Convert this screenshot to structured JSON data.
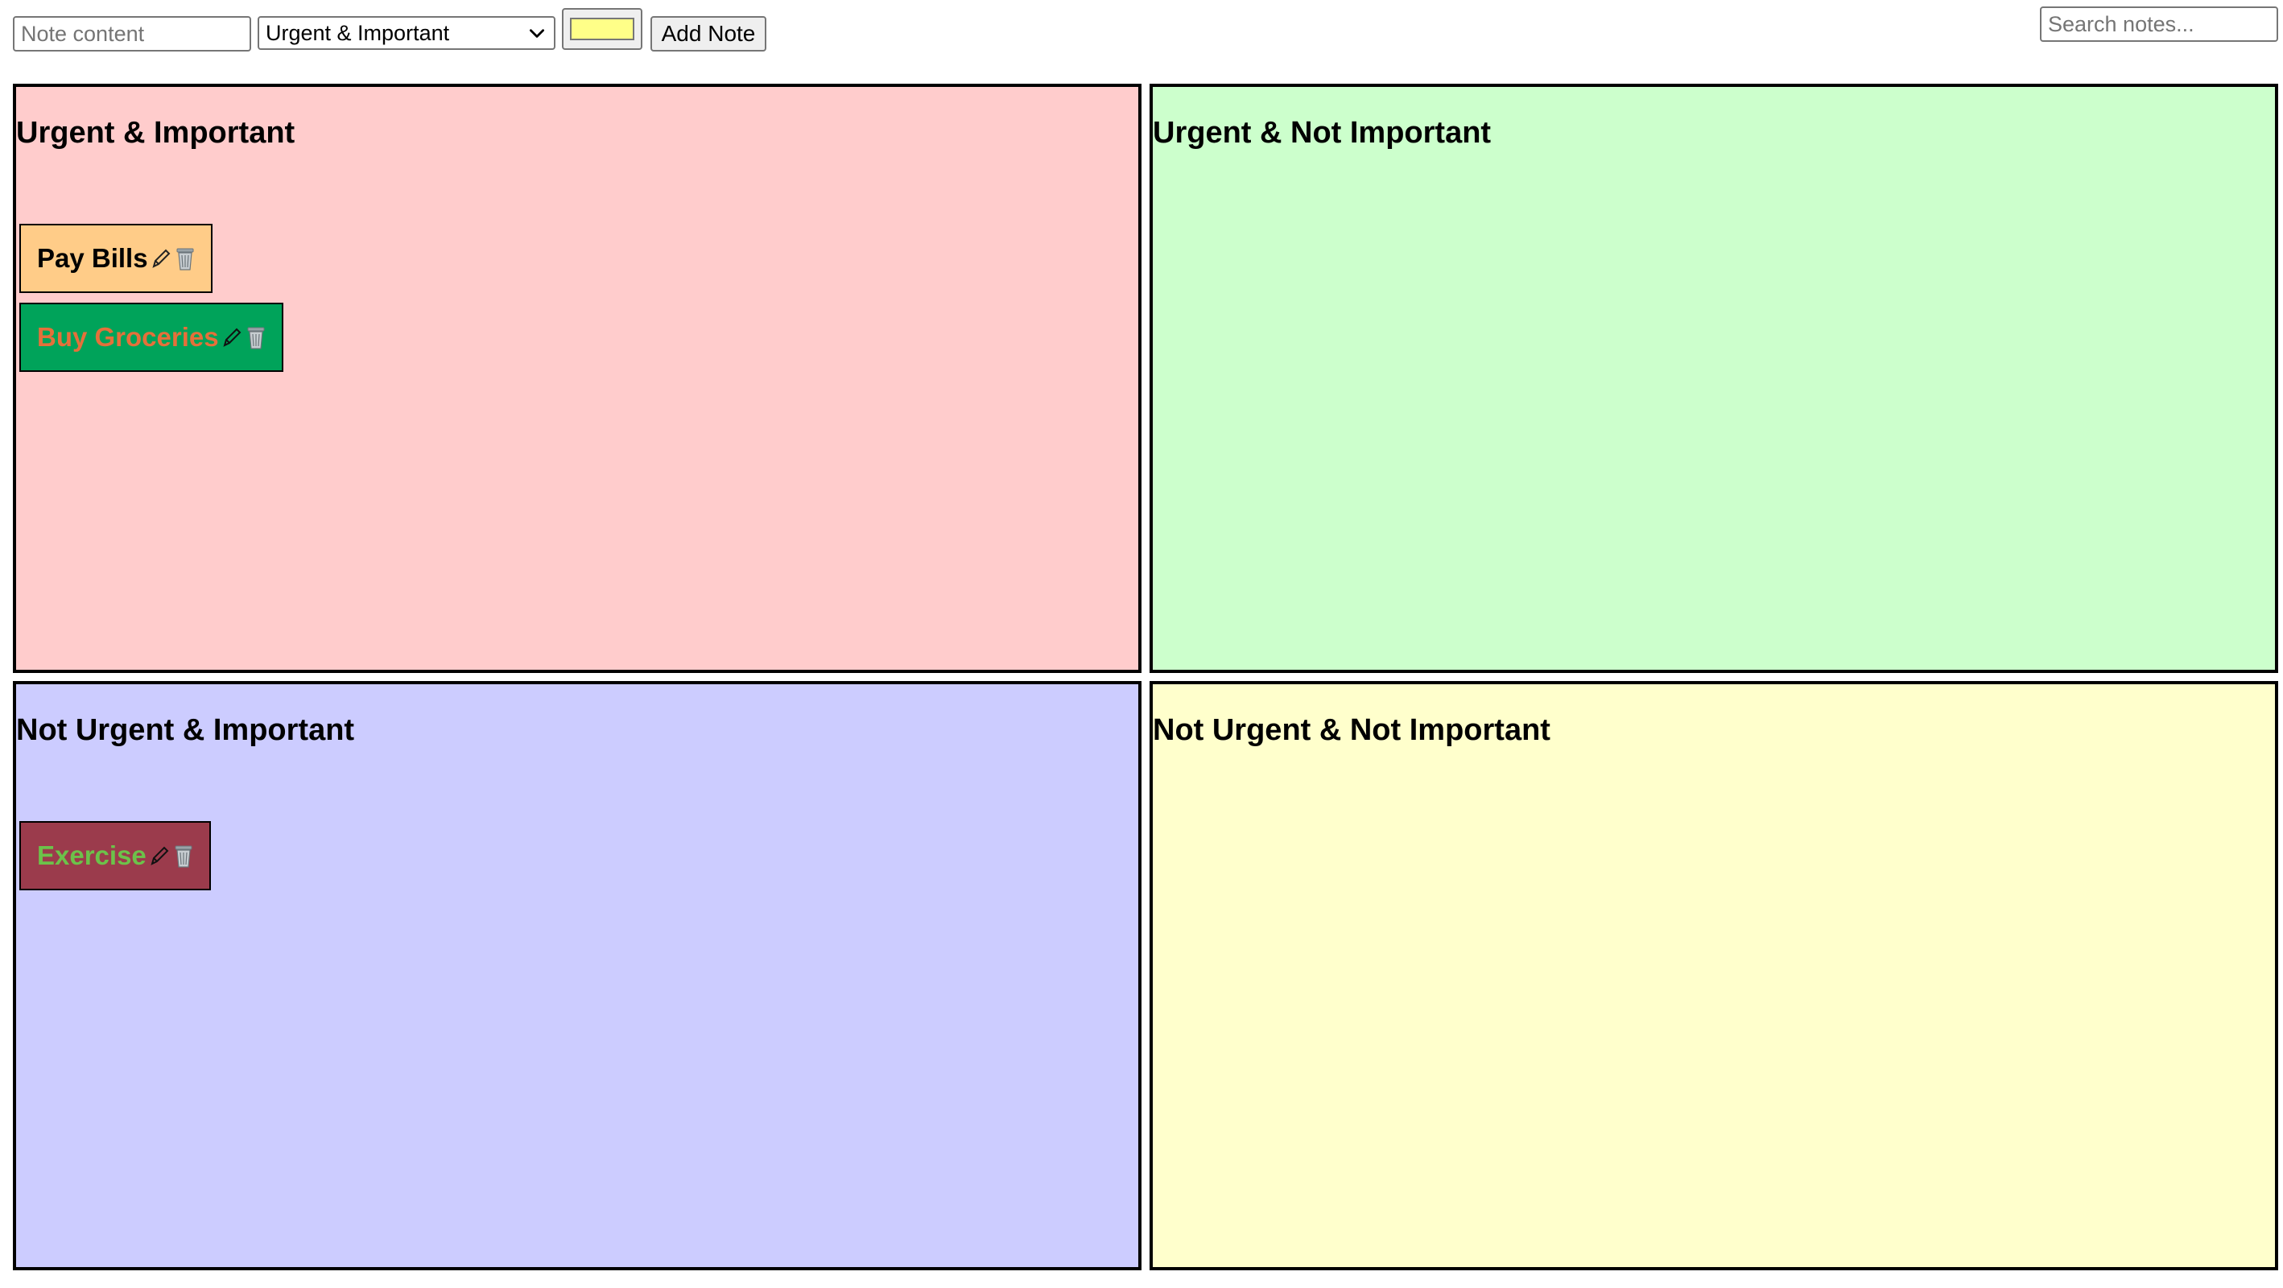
{
  "toolbar": {
    "note_input_placeholder": "Note content",
    "category_selected": "Urgent & Important",
    "color_value": "#ffff88",
    "add_label": "Add Note",
    "search_placeholder": "Search notes..."
  },
  "quadrants": [
    {
      "title": "Urgent & Important",
      "background": "#ffcccc",
      "notes": [
        {
          "text": "Pay Bills",
          "background": "#ffcc88",
          "color": "#000000"
        },
        {
          "text": "Buy Groceries",
          "background": "#00a35a",
          "color": "#e5703a"
        }
      ]
    },
    {
      "title": "Urgent & Not Important",
      "background": "#ccffcc",
      "notes": []
    },
    {
      "title": "Not Urgent & Important",
      "background": "#ccccff",
      "notes": [
        {
          "text": "Exercise",
          "background": "#9b3b4c",
          "color": "#6cc24a"
        }
      ]
    },
    {
      "title": "Not Urgent & Not Important",
      "background": "#ffffcc",
      "notes": []
    }
  ],
  "icons": {
    "edit": "pencil-icon",
    "delete": "trash-icon"
  }
}
